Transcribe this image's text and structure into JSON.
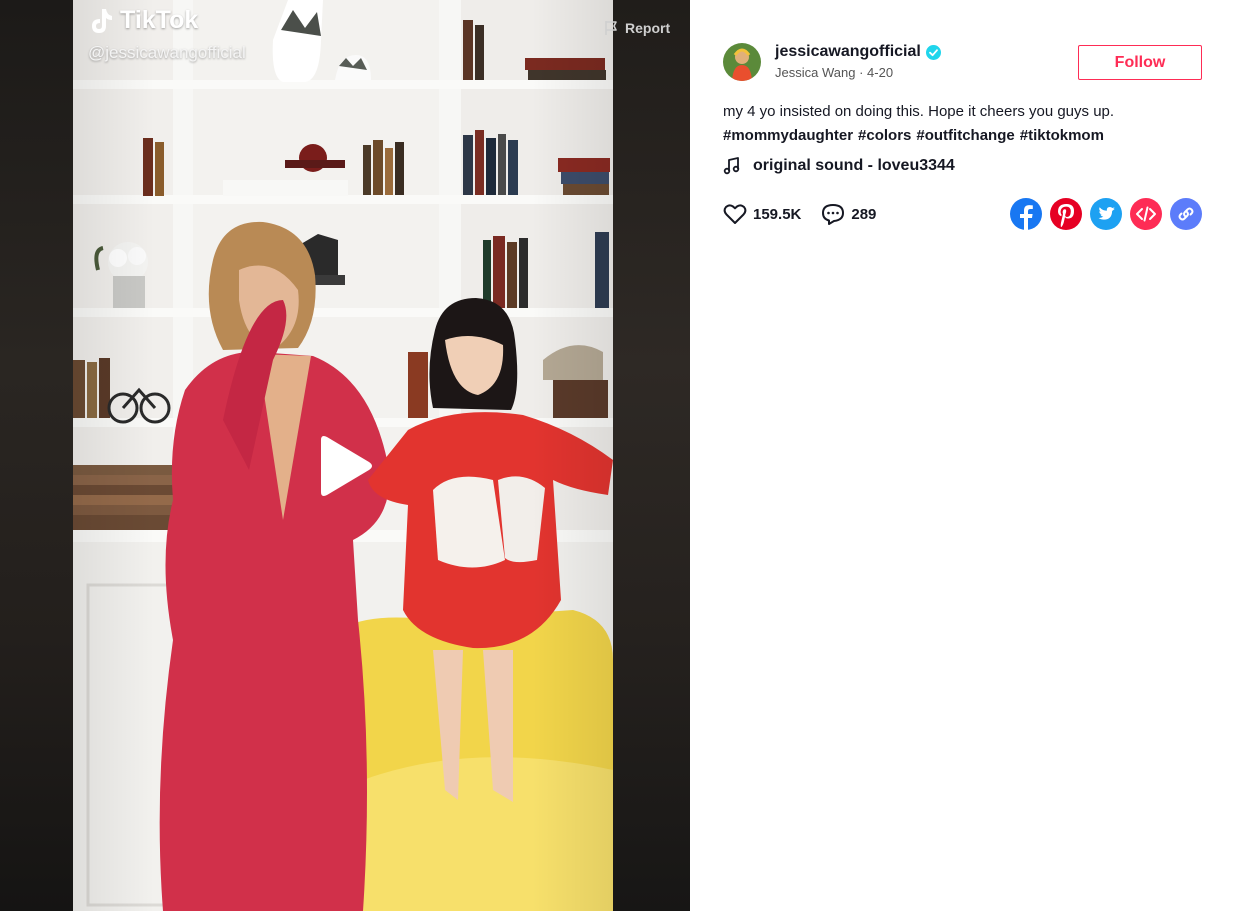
{
  "video": {
    "watermark_brand": "TikTok",
    "watermark_handle": "@jessicawangofficial",
    "report_label": "Report",
    "play_icon": "play-icon"
  },
  "author": {
    "username": "jessicawangofficial",
    "verified": true,
    "display_name": "Jessica Wang",
    "separator": "·",
    "date": "4-20"
  },
  "follow_label": "Follow",
  "caption": {
    "text": "my 4 yo insisted on doing this. Hope it cheers you guys up.",
    "hashtags": [
      "#mommydaughter",
      "#colors",
      "#outfitchange",
      "#tiktokmom"
    ]
  },
  "sound": {
    "icon": "music-note-icon",
    "label": "original sound - loveu3344"
  },
  "stats": {
    "likes": "159.5K",
    "comments": "289"
  },
  "share_targets": [
    "facebook",
    "pinterest",
    "twitter",
    "embed",
    "copy-link"
  ],
  "colors": {
    "accent": "#fe2c55",
    "verified": "#20d5ec",
    "facebook": "#1877f2",
    "pinterest": "#e60023",
    "twitter": "#1da1f2",
    "embed": "#fe2c55",
    "link": "#5c7cfa"
  }
}
